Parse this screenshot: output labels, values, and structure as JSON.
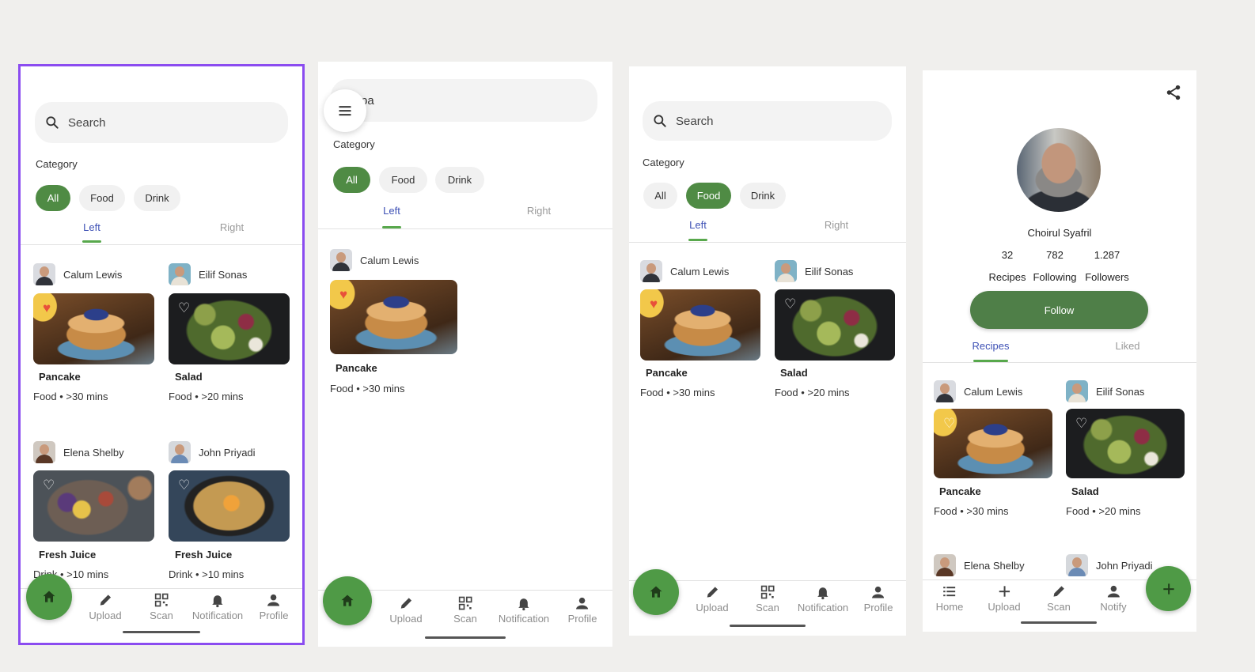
{
  "colors": {
    "accent_green": "#4f8b44",
    "tab_active": "#3e51b5",
    "selection_outline": "#8b4cf0",
    "heart": "#e8503a"
  },
  "search_placeholder": "Search",
  "search_typed": "pa",
  "category_label": "Category",
  "chips": {
    "all": "All",
    "food": "Food",
    "drink": "Drink"
  },
  "tabs": {
    "left": "Left",
    "right": "Right",
    "recipes": "Recipes",
    "liked": "Liked"
  },
  "recipes": [
    {
      "author": "Calum Lewis",
      "name": "Pancake",
      "meta": "Food • >30 mins",
      "image": "pancake",
      "liked": true
    },
    {
      "author": "Eilif Sonas",
      "name": "Salad",
      "meta": "Food • >20 mins",
      "image": "salad",
      "liked": false
    },
    {
      "author": "Elena Shelby",
      "name": "Fresh Juice",
      "meta": "Drink • >10 mins",
      "image": "fruit-bowl",
      "liked": false
    },
    {
      "author": "John Priyadi",
      "name": "Fresh Juice",
      "meta": "Drink • >10 mins",
      "image": "dessert-pan",
      "liked": false
    }
  ],
  "nav": {
    "upload": "Upload",
    "scan": "Scan",
    "notification": "Notification",
    "profile": "Profile",
    "home": "Home",
    "notify": "Notify"
  },
  "profile": {
    "name": "Choirul Syafril",
    "stats": [
      {
        "value": "32",
        "label": "Recipes"
      },
      {
        "value": "782",
        "label": "Following"
      },
      {
        "value": "1.287",
        "label": "Followers"
      }
    ],
    "follow_label": "Follow"
  }
}
